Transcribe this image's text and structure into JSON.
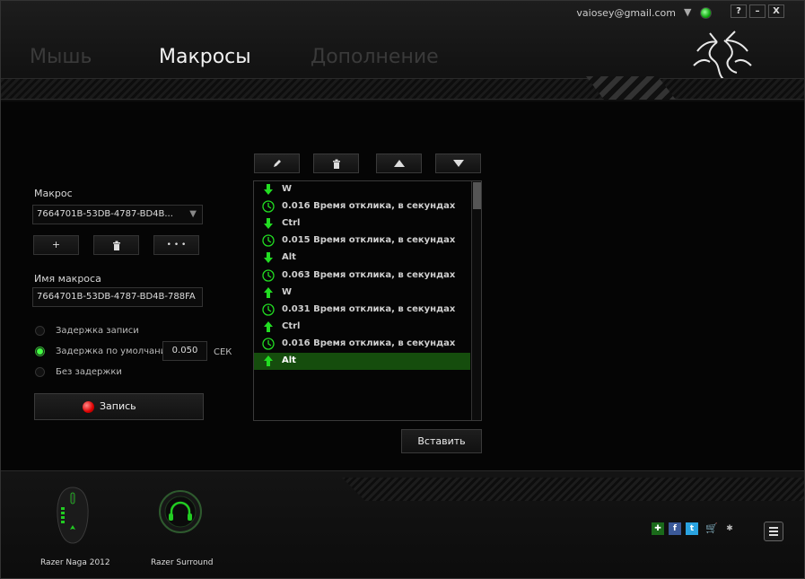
{
  "header": {
    "user_email": "vaiosey@gmail.com",
    "status_color": "#33cc33",
    "window_buttons": [
      "?",
      "–",
      "X"
    ],
    "tabs": [
      {
        "label": "Мышь",
        "state": "inactive"
      },
      {
        "label": "Макросы",
        "state": "active"
      },
      {
        "label": "Дополнение",
        "state": "inactive"
      }
    ]
  },
  "macro_panel": {
    "macro_label": "Макрос",
    "macro_select_value": "7664701B-53DB-4787-BD4B...",
    "add_button": "+",
    "more_button": "• • •",
    "name_label": "Имя макроса",
    "name_value": "7664701B-53DB-4787-BD4B-788FA",
    "delay_options": [
      {
        "label": "Задержка записи",
        "selected": false
      },
      {
        "label": "Задержка по умолчанию",
        "selected": true
      },
      {
        "label": "Без задержки",
        "selected": false
      }
    ],
    "default_delay_value": "0.050",
    "delay_unit": "СЕК",
    "record_button": "Запись"
  },
  "macro_list": {
    "rows": [
      {
        "type": "key-down",
        "icon": "arrow-down-icon",
        "text": "W"
      },
      {
        "type": "delay",
        "icon": "clock-icon",
        "text": "0.016 Время отклика, в секундах"
      },
      {
        "type": "key-down",
        "icon": "arrow-down-icon",
        "text": "Ctrl"
      },
      {
        "type": "delay",
        "icon": "clock-icon",
        "text": "0.015 Время отклика, в секундах"
      },
      {
        "type": "key-down",
        "icon": "arrow-down-icon",
        "text": "Alt"
      },
      {
        "type": "delay",
        "icon": "clock-icon",
        "text": "0.063 Время отклика, в секундах"
      },
      {
        "type": "key-up",
        "icon": "arrow-up-icon",
        "text": "W"
      },
      {
        "type": "delay",
        "icon": "clock-icon",
        "text": "0.031 Время отклика, в секундах"
      },
      {
        "type": "key-up",
        "icon": "arrow-up-icon",
        "text": "Ctrl"
      },
      {
        "type": "delay",
        "icon": "clock-icon",
        "text": "0.016 Время отклика, в секундах"
      },
      {
        "type": "key-up",
        "icon": "arrow-up-icon",
        "text": "Alt",
        "selected": true
      }
    ],
    "insert_button": "Вставить",
    "accent_color": "#22dd22"
  },
  "devices": [
    {
      "name": "Razer Naga 2012"
    },
    {
      "name": "Razer Surround"
    }
  ]
}
